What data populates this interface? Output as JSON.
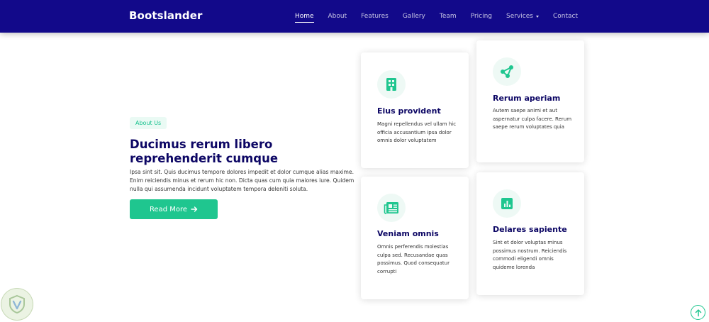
{
  "header": {
    "brand": "Bootslander",
    "nav": [
      {
        "label": "Home",
        "active": true
      },
      {
        "label": "About"
      },
      {
        "label": "Features"
      },
      {
        "label": "Gallery"
      },
      {
        "label": "Team"
      },
      {
        "label": "Pricing"
      },
      {
        "label": "Services",
        "dropdown": true
      },
      {
        "label": "Contact"
      }
    ]
  },
  "about": {
    "badge": "About Us",
    "title": "Ducimus rerum libero reprehenderit cumque",
    "description": "Ipsa sint sit. Quis ducimus tempore dolores impedit et dolor cumque alias maxime. Enim reiciendis minus et rerum hic non. Dicta quas cum quia maiores iure. Quidem nulla qui assumenda incidunt voluptatem tempora deleniti soluta.",
    "button": "Read More",
    "button_icon": "arrow-right-icon"
  },
  "features": [
    {
      "icon": "building-icon",
      "title": "Eius provident",
      "text": "Magni repellendus vel ullam hic officia accusantium ipsa dolor omnis dolor voluptatem"
    },
    {
      "icon": "share-nodes-icon",
      "title": "Rerum aperiam",
      "text": "Autem saepe animi et aut aspernatur culpa facere. Rerum saepe rerum voluptates quia"
    },
    {
      "icon": "newspaper-icon",
      "title": "Veniam omnis",
      "text": "Omnis perferendis molestias culpa sed. Recusandae quas possimus. Quod consequatur corrupti"
    },
    {
      "icon": "bar-chart-icon",
      "title": "Delares sapiente",
      "text": "Sint et dolor voluptas minus possimus nostrum. Reiciendis commodi eligendi omnis quideme lorenda"
    }
  ],
  "colors": {
    "header_bg": "#12098a",
    "accent": "#1fc68f",
    "title": "#0c0664"
  },
  "back_to_top_icon": "arrow-up-circle-icon",
  "watermark_icon": "shield-logo-icon"
}
